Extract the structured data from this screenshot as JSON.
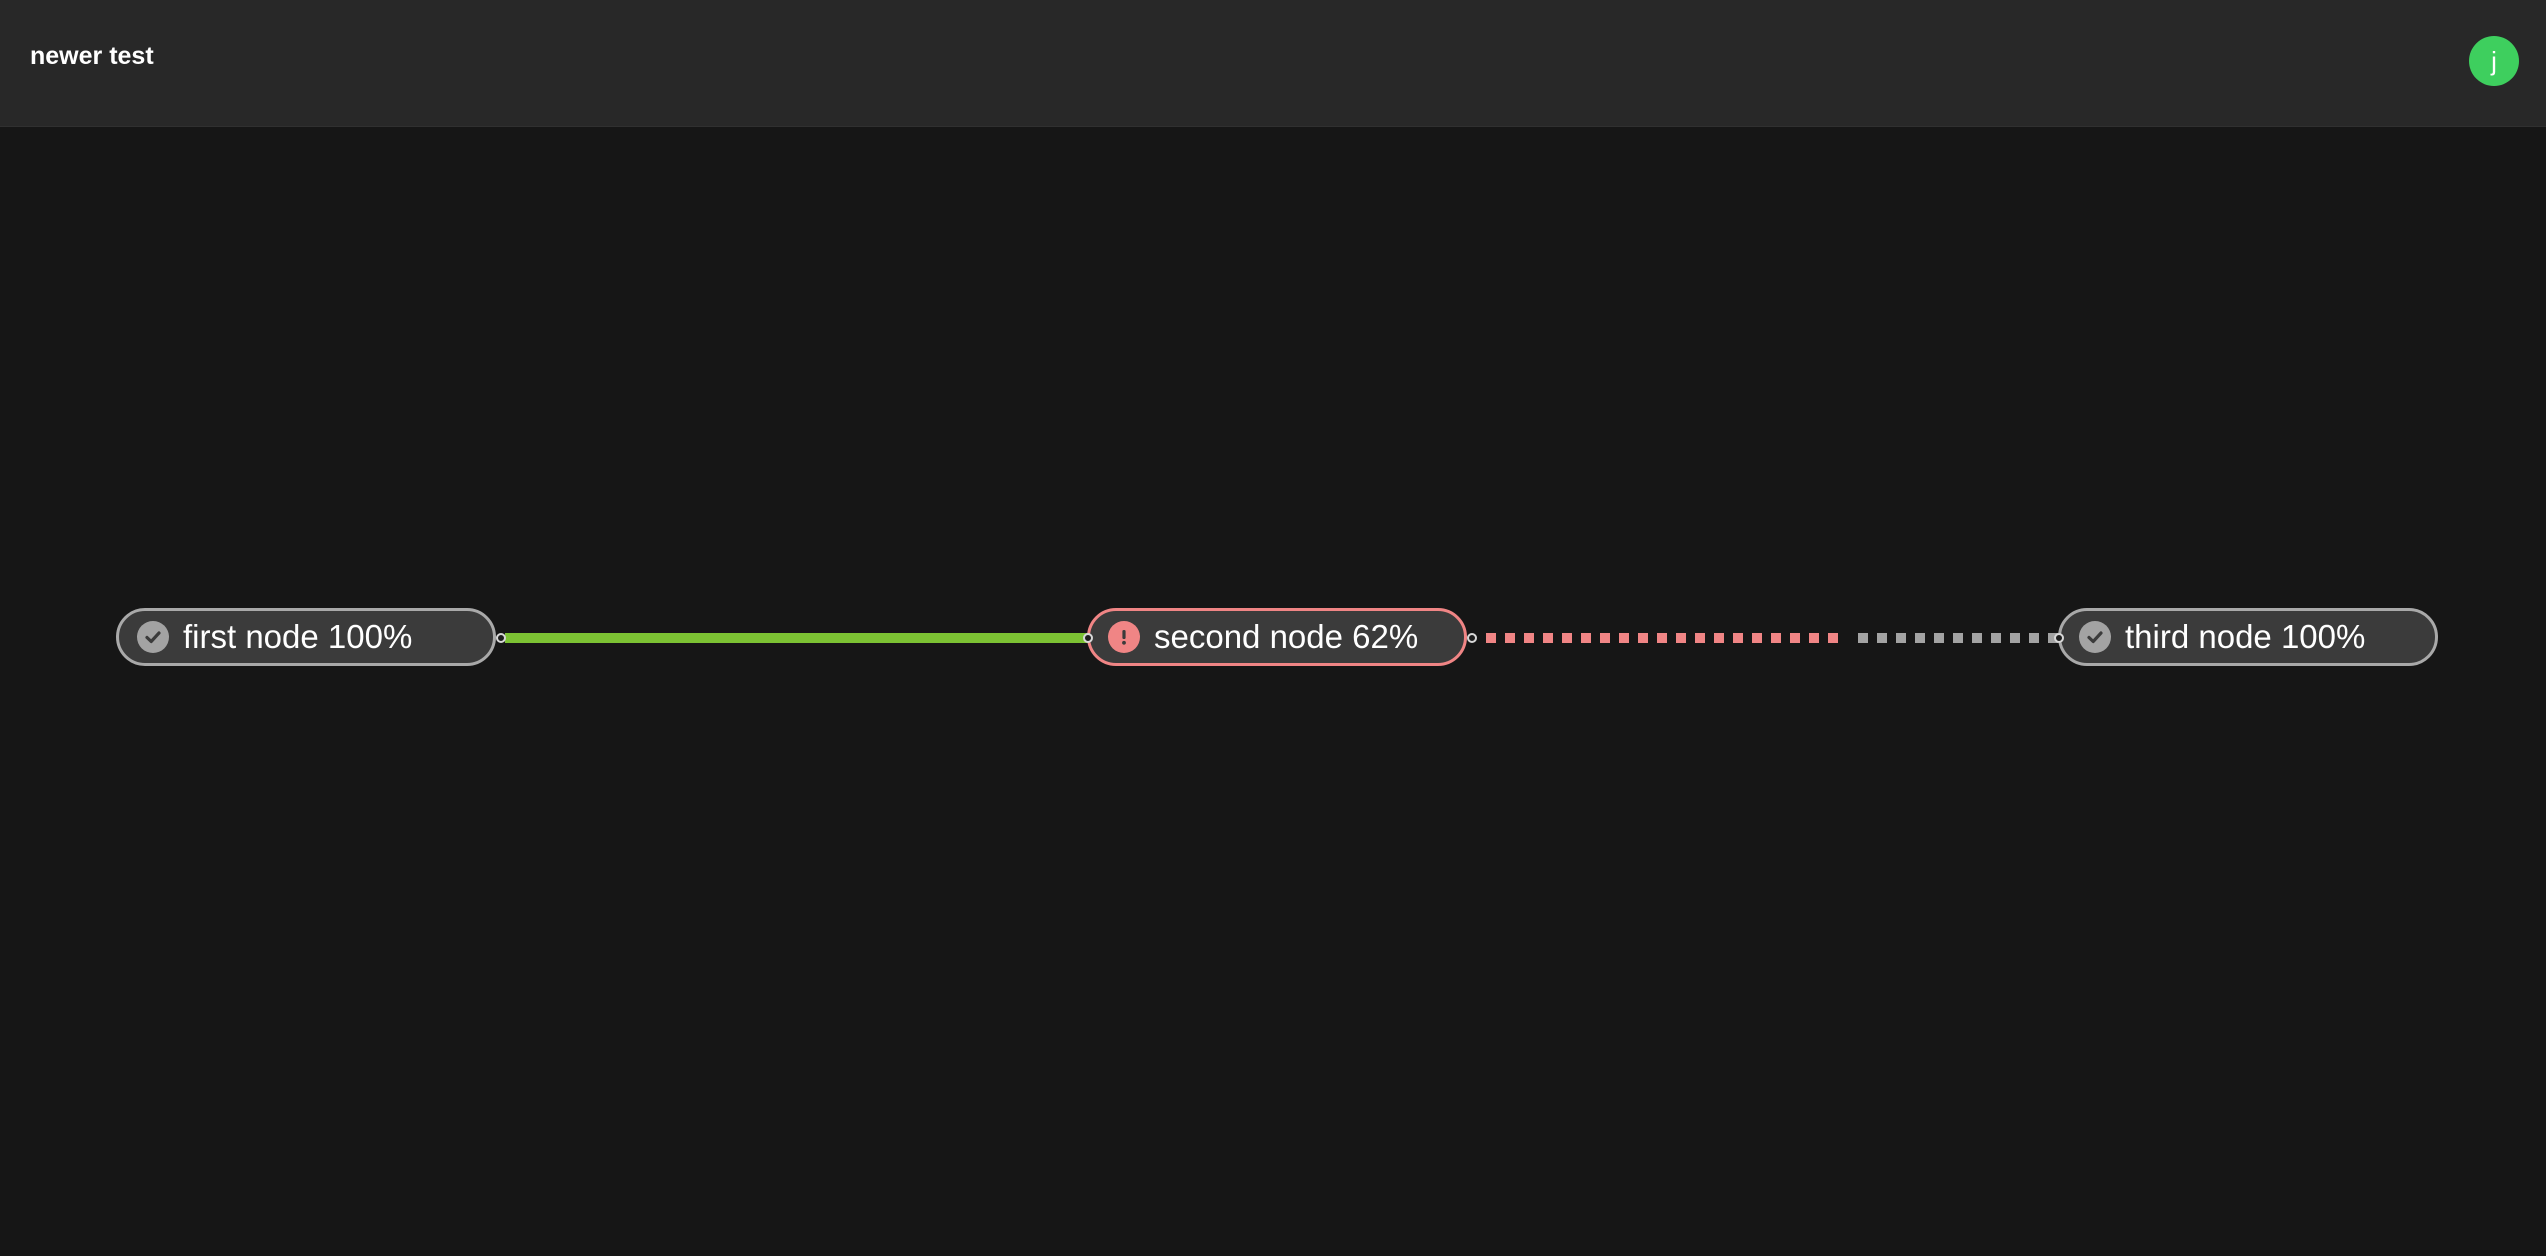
{
  "header": {
    "title": "newer test",
    "avatar_initial": "j"
  },
  "colors": {
    "background": "#161616",
    "header_background": "#282828",
    "avatar": "#3ecf5e",
    "node_fill": "#3b3b3b",
    "node_border": "#a9a9a9",
    "error": "#f08585",
    "edge_complete": "#7cc233",
    "edge_pending": "#a3a3a3"
  },
  "nodes": [
    {
      "label": "first node 100%",
      "status": "complete",
      "icon": "check-circle-icon"
    },
    {
      "label": "second node 62%",
      "status": "error",
      "icon": "exclamation-circle-icon"
    },
    {
      "label": "third node 100%",
      "status": "complete",
      "icon": "check-circle-icon"
    }
  ],
  "edges": [
    {
      "from": "first node",
      "to": "second node",
      "style": "solid",
      "color": "#7cc233"
    },
    {
      "from": "second node",
      "to": "third node",
      "style": "dotted",
      "progress": 0.62,
      "color": "#f08585",
      "remaining_color": "#a3a3a3"
    }
  ]
}
